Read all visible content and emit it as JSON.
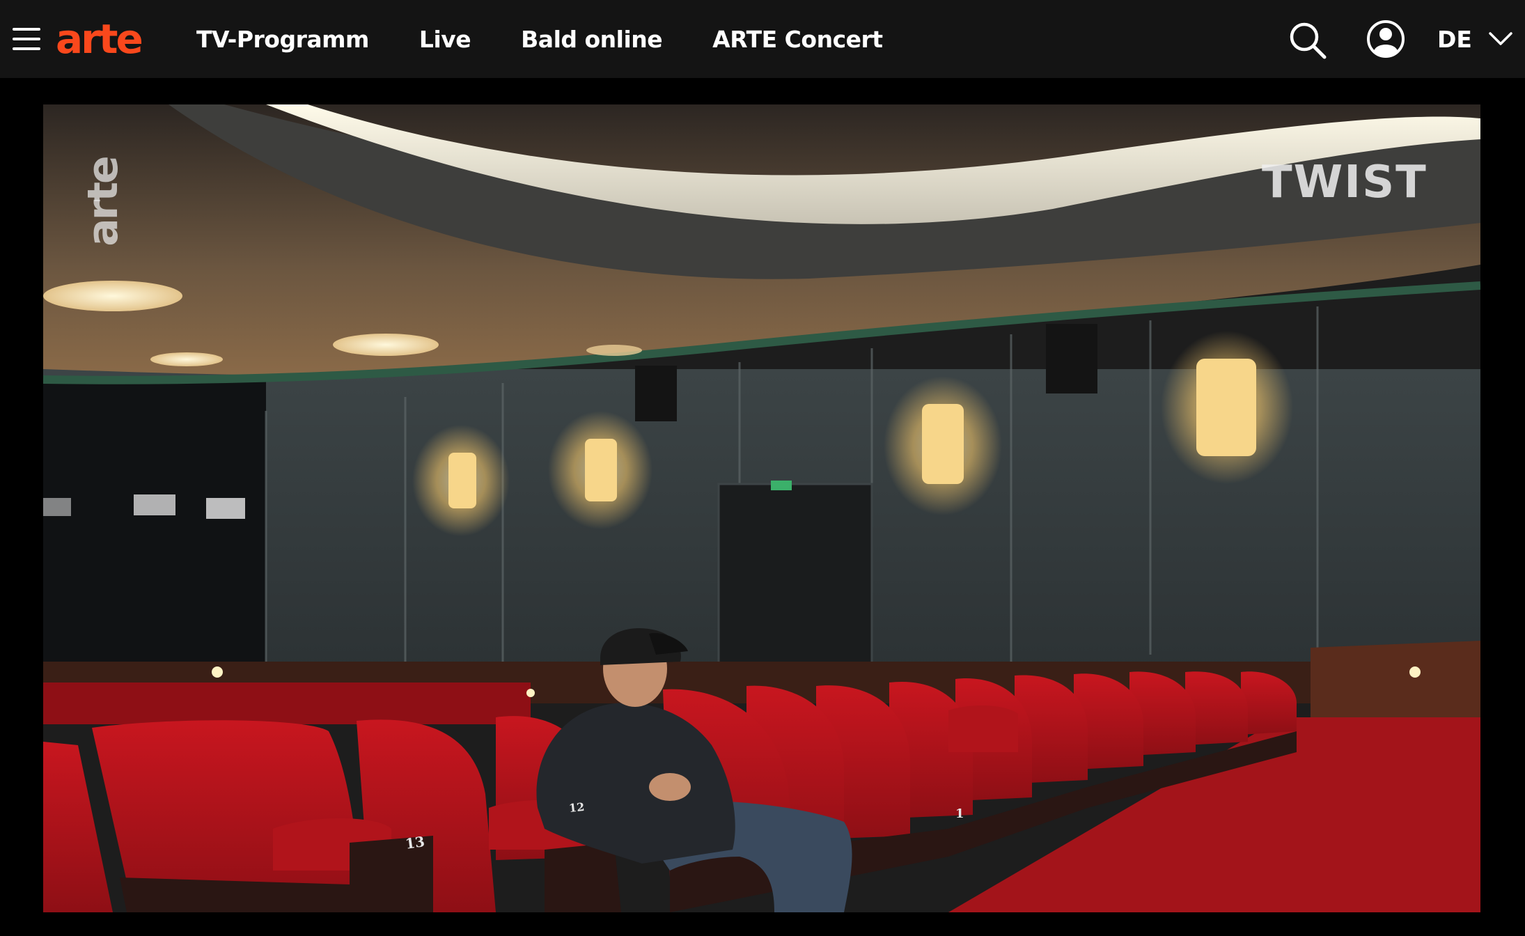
{
  "header": {
    "logo": "arte",
    "nav": [
      {
        "label": "TV-Programm"
      },
      {
        "label": "Live"
      },
      {
        "label": "Bald online"
      },
      {
        "label": "ARTE Concert"
      }
    ],
    "language": "DE"
  },
  "video": {
    "watermark_channel": "arte",
    "watermark_show": "TWIST",
    "seat_numbers": [
      "13",
      "12",
      "1"
    ]
  },
  "colors": {
    "brand": "#fa481c",
    "navbar_bg": "#141414",
    "seat_red": "#b1141b",
    "carpet_red": "#a3141a"
  },
  "icons": {
    "menu": "hamburger-menu-icon",
    "search": "search-icon",
    "account": "user-account-icon",
    "language_toggle": "chevron-down-icon"
  }
}
